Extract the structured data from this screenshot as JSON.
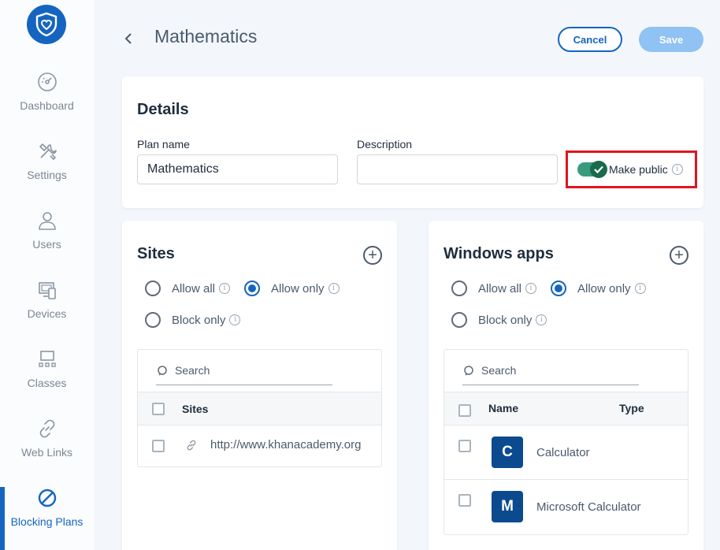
{
  "sidebar": {
    "items": [
      {
        "label": "Dashboard",
        "icon": "dashboard-icon"
      },
      {
        "label": "Settings",
        "icon": "settings-icon"
      },
      {
        "label": "Users",
        "icon": "user-icon"
      },
      {
        "label": "Devices",
        "icon": "devices-icon"
      },
      {
        "label": "Classes",
        "icon": "classes-icon"
      },
      {
        "label": "Web Links",
        "icon": "link-icon"
      },
      {
        "label": "Blocking Plans",
        "icon": "blocked-icon",
        "active": true
      }
    ]
  },
  "header": {
    "title": "Mathematics",
    "cancel_label": "Cancel",
    "save_label": "Save"
  },
  "details": {
    "title": "Details",
    "plan_name_label": "Plan name",
    "plan_name_value": "Mathematics",
    "description_label": "Description",
    "description_value": "",
    "make_public_label": "Make public",
    "make_public_on": true
  },
  "sites": {
    "title": "Sites",
    "options": {
      "allow_all": "Allow all",
      "allow_only": "Allow only",
      "block_only": "Block only"
    },
    "selected": "allow_only",
    "search_placeholder": "Search",
    "column_header": "Sites",
    "rows": [
      {
        "url": "http://www.khanacademy.org"
      }
    ]
  },
  "apps": {
    "title": "Windows apps",
    "options": {
      "allow_all": "Allow all",
      "allow_only": "Allow only",
      "block_only": "Block only"
    },
    "selected": "allow_only",
    "search_placeholder": "Search",
    "columns": {
      "name": "Name",
      "type": "Type"
    },
    "rows": [
      {
        "initial": "C",
        "name": "Calculator"
      },
      {
        "initial": "M",
        "name": "Microsoft Calculator"
      }
    ]
  },
  "colors": {
    "accent": "#1565c0",
    "save_disabled": "#90c2f3",
    "toggle_on": "#3a9b7c",
    "highlight_box": "#e0141e",
    "app_tile": "#0b4a8f"
  }
}
